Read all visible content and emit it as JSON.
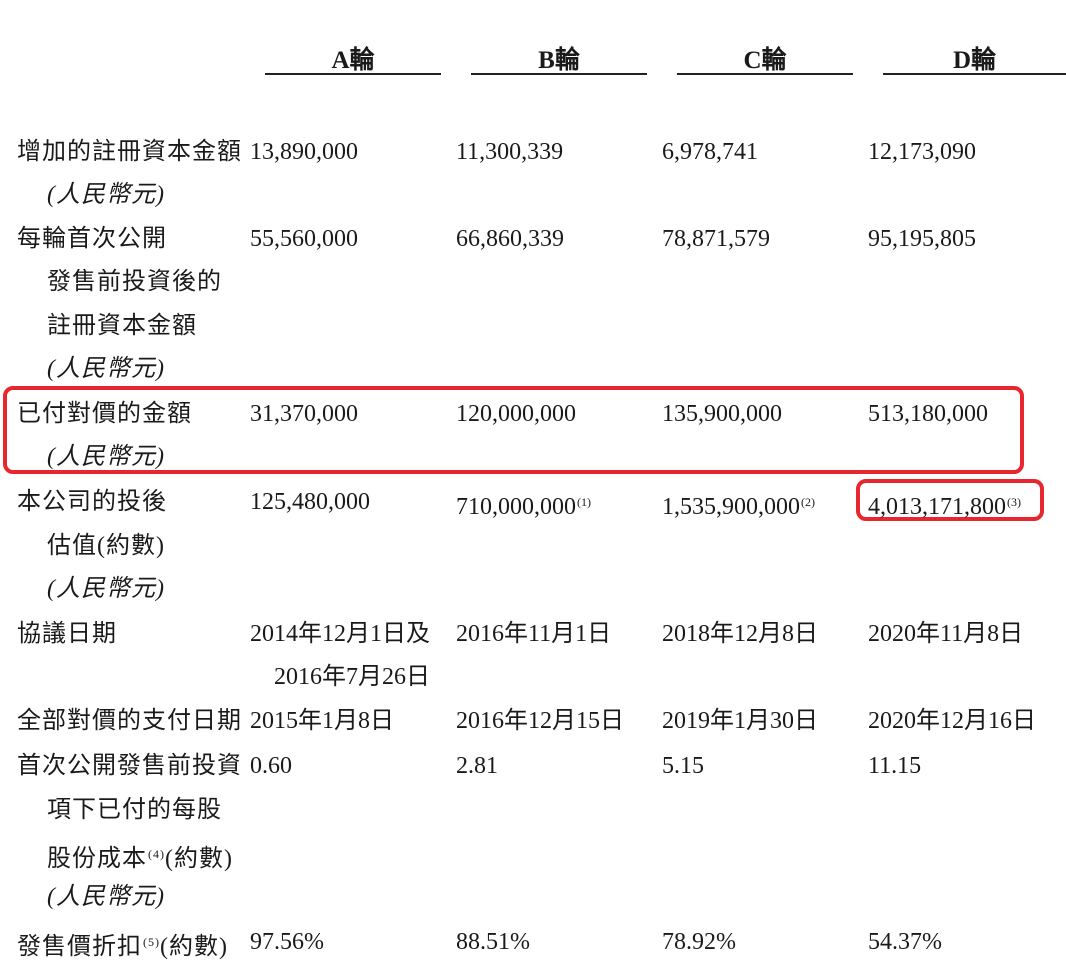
{
  "headers": [
    "A輪",
    "B輪",
    "C輪",
    "D輪"
  ],
  "rows": {
    "r0": {
      "label": [
        "增加的註冊資本金額",
        "(人民幣元)"
      ],
      "values": [
        "13,890,000",
        "11,300,339",
        "6,978,741",
        "12,173,090"
      ]
    },
    "r1": {
      "label": [
        "每輪首次公開",
        "發售前投資後的",
        "註冊資本金額",
        "(人民幣元)"
      ],
      "values": [
        "55,560,000",
        "66,860,339",
        "78,871,579",
        "95,195,805"
      ]
    },
    "r2": {
      "label": [
        "已付對價的金額",
        "(人民幣元)"
      ],
      "values": [
        "31,370,000",
        "120,000,000",
        "135,900,000",
        "513,180,000"
      ]
    },
    "r3": {
      "label": [
        "本公司的投後",
        "估值(約數)",
        "(人民幣元)"
      ],
      "values": [
        "125,480,000",
        "710,000,000",
        "1,535,900,000",
        "4,013,171,800"
      ],
      "notes": [
        "",
        "(1)",
        "(2)",
        "(3)"
      ]
    },
    "r4": {
      "label": [
        "協議日期"
      ],
      "values": [
        "2014年12月1日及",
        "2016年11月1日",
        "2018年12月8日",
        "2020年11月8日"
      ],
      "extra": "2016年7月26日"
    },
    "r5": {
      "label": [
        "全部對價的支付日期"
      ],
      "values": [
        "2015年1月8日",
        "2016年12月15日",
        "2019年1月30日",
        "2020年12月16日"
      ]
    },
    "r6": {
      "label": [
        "首次公開發售前投資",
        "項下已付的每股",
        "股份成本",
        "(約數)",
        "(人民幣元)"
      ],
      "note": "(4)",
      "values": [
        "0.60",
        "2.81",
        "5.15",
        "11.15"
      ]
    },
    "r7": {
      "label": [
        "發售價折扣",
        "(約數)"
      ],
      "note": "(5)",
      "values": [
        "97.56%",
        "88.51%",
        "78.92%",
        "54.37%"
      ]
    }
  },
  "highlight_color": "#e8262d"
}
